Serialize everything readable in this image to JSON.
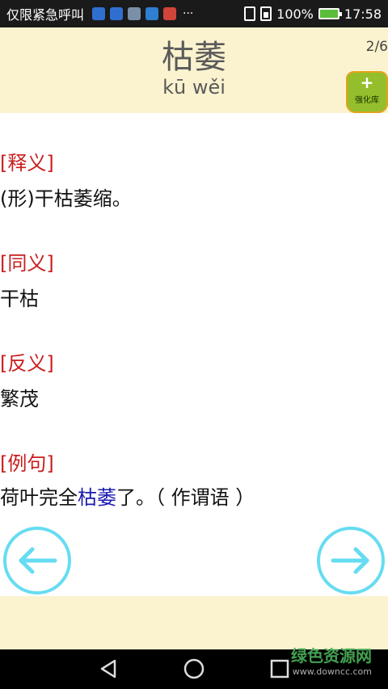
{
  "status_bar": {
    "carrier": "仅限紧急呼叫",
    "more": "···",
    "battery": "100%",
    "time": "17:58",
    "icons": [
      "notification-blue-icon",
      "usb-icon",
      "image-icon",
      "shield-app-icon",
      "app-red-icon",
      "vibrate-icon",
      "sim-icon",
      "battery-charging-icon"
    ]
  },
  "header": {
    "word": "枯萎",
    "pinyin": "kū wěi",
    "page_counter": "2/6",
    "strengthen_plus": "+",
    "strengthen_label": "强化库"
  },
  "sections": [
    {
      "label": "[释义]",
      "text": "(形)干枯萎缩。"
    },
    {
      "label": "[同义]",
      "text": "干枯"
    },
    {
      "label": "[反义]",
      "text": "繁茂"
    },
    {
      "label": "[例句]",
      "text_before": "荷叶完全",
      "text_highlight": "枯萎",
      "text_after": "了。（ 作谓语 ）"
    }
  ],
  "colors": {
    "header_bg": "#fbf3cf",
    "label_red": "#c81e1e",
    "highlight_blue": "#1a1ab0",
    "arrow_cyan": "#66dcf2",
    "badge_green": "#94be2c"
  },
  "watermark": {
    "cn": "绿色资源网",
    "url": "www.downcc.com"
  }
}
